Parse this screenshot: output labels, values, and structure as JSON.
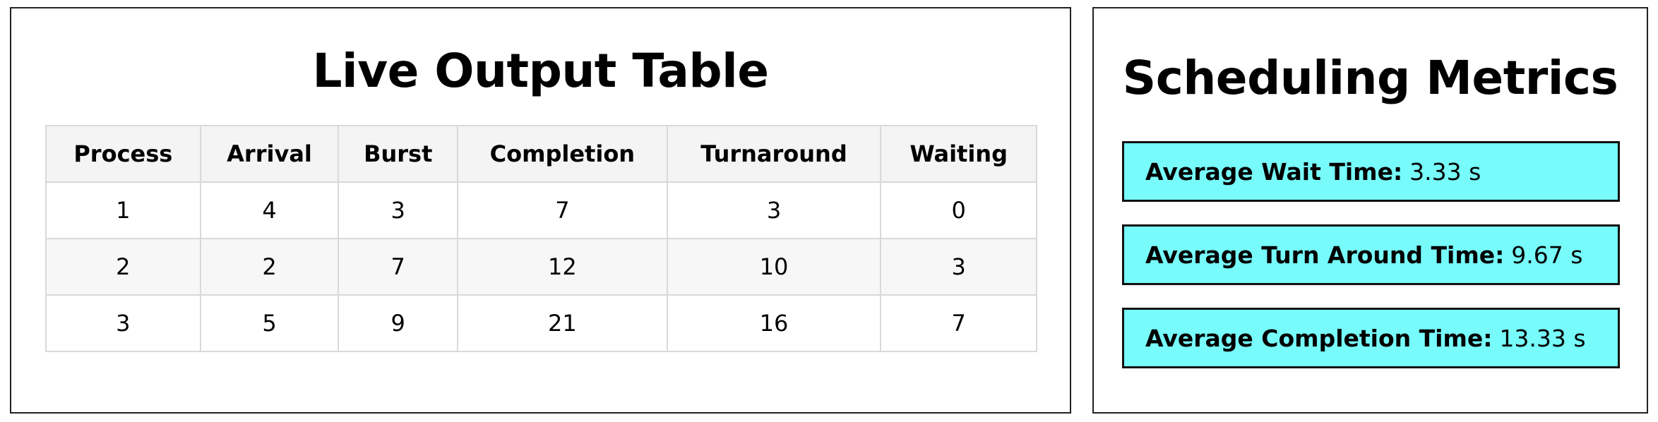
{
  "output_table": {
    "title": "Live Output Table",
    "columns": [
      "Process",
      "Arrival",
      "Burst",
      "Completion",
      "Turnaround",
      "Waiting"
    ],
    "rows": [
      [
        "1",
        "4",
        "3",
        "7",
        "3",
        "0"
      ],
      [
        "2",
        "2",
        "7",
        "12",
        "10",
        "3"
      ],
      [
        "3",
        "5",
        "9",
        "21",
        "16",
        "7"
      ]
    ]
  },
  "metrics": {
    "title": "Scheduling Metrics",
    "items": [
      {
        "label": "Average Wait Time:",
        "value": "3.33 s"
      },
      {
        "label": "Average Turn Around Time:",
        "value": "9.67 s"
      },
      {
        "label": "Average Completion Time:",
        "value": "13.33 s"
      }
    ]
  },
  "colors": {
    "metric_background": "#77fbfb",
    "table_header_background": "#f4f4f4",
    "table_border": "#d9d9d9"
  }
}
